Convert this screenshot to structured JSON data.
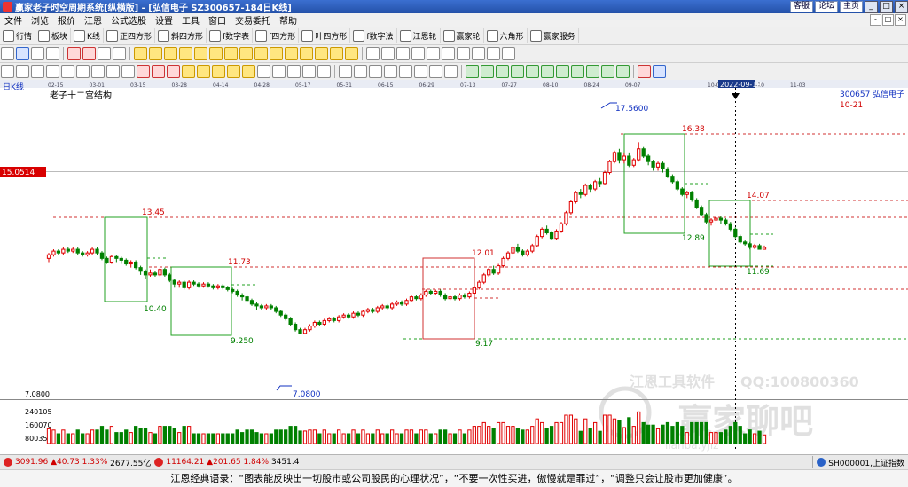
{
  "window": {
    "title": "赢家老子时空周期系统[纵横版] - [弘信电子  SZ300657-184日K线]",
    "links": [
      "客服",
      "论坛",
      "主页"
    ]
  },
  "menu": [
    "文件",
    "浏览",
    "报价",
    "江恩",
    "公式选股",
    "设置",
    "工具",
    "窗口",
    "交易委托",
    "帮助"
  ],
  "toolbar1": [
    "行情",
    "板块",
    "K线",
    "正四方形",
    "斜四方形",
    "f数字表",
    "f四方形",
    "叶四方形",
    "f数字法",
    "江恩轮",
    "赢家轮",
    "六角形",
    "赢家服务"
  ],
  "chart_data": {
    "type": "candlestick",
    "period_label": "日K线",
    "subtitle": "老子十二宫结构",
    "stock_code": "300657",
    "stock_name": "弘信电子",
    "date_axis": [
      "02-15",
      "03-01",
      "03-15",
      "03-28",
      "04-14",
      "04-28",
      "05-17",
      "05-31",
      "06-15",
      "06-29",
      "07-13",
      "07-27",
      "08-10",
      "08-24",
      "09-07",
      "2022-09-19",
      "10-06",
      "10-20",
      "11-03"
    ],
    "selected_date": "2022-09-19",
    "right_label": "10-21",
    "price_tag": "15.0514",
    "min_price_label": "7.0800",
    "volume_ticks": [
      "240105",
      "160070",
      "80035"
    ],
    "annotations": [
      {
        "text": "13.45",
        "color": "red"
      },
      {
        "text": "10.40",
        "color": "green"
      },
      {
        "text": "11.73",
        "color": "red"
      },
      {
        "text": "9.250",
        "color": "green"
      },
      {
        "text": "7.0800",
        "color": "blue"
      },
      {
        "text": "12.01",
        "color": "red"
      },
      {
        "text": "9.17",
        "color": "green"
      },
      {
        "text": "17.5600",
        "color": "blue"
      },
      {
        "text": "16.38",
        "color": "red"
      },
      {
        "text": "12.89",
        "color": "green"
      },
      {
        "text": "14.07",
        "color": "red"
      },
      {
        "text": "11.69",
        "color": "green"
      }
    ],
    "candles": [
      [
        11.2,
        11.4,
        11.0,
        11.5
      ],
      [
        11.4,
        11.6,
        11.3,
        11.7
      ],
      [
        11.6,
        11.5,
        11.4,
        11.7
      ],
      [
        11.5,
        11.7,
        11.4,
        11.8
      ],
      [
        11.7,
        11.6,
        11.5,
        11.8
      ],
      [
        11.6,
        11.7,
        11.5,
        11.8
      ],
      [
        11.7,
        11.5,
        11.4,
        11.8
      ],
      [
        11.5,
        11.4,
        11.3,
        11.6
      ],
      [
        11.4,
        11.5,
        11.3,
        11.6
      ],
      [
        11.5,
        11.7,
        11.4,
        11.8
      ],
      [
        11.7,
        11.5,
        11.4,
        11.8
      ],
      [
        11.5,
        11.2,
        11.1,
        11.6
      ],
      [
        11.2,
        11.0,
        10.9,
        11.3
      ],
      [
        11.0,
        11.3,
        10.9,
        11.4
      ],
      [
        11.3,
        11.2,
        11.0,
        11.4
      ],
      [
        11.2,
        11.1,
        10.9,
        11.3
      ],
      [
        11.1,
        10.9,
        10.8,
        11.2
      ],
      [
        10.9,
        11.0,
        10.7,
        11.1
      ],
      [
        11.0,
        10.7,
        10.6,
        11.1
      ],
      [
        10.7,
        10.5,
        10.3,
        10.8
      ],
      [
        10.5,
        10.3,
        10.1,
        10.6
      ],
      [
        10.3,
        10.4,
        10.2,
        10.6
      ],
      [
        10.4,
        10.3,
        10.2,
        10.5
      ],
      [
        10.3,
        10.6,
        10.2,
        10.7
      ],
      [
        10.6,
        10.3,
        10.2,
        10.7
      ],
      [
        10.3,
        10.0,
        9.9,
        10.4
      ],
      [
        10.0,
        9.8,
        9.6,
        10.1
      ],
      [
        9.8,
        9.9,
        9.6,
        10.0
      ],
      [
        9.9,
        9.6,
        9.5,
        10.0
      ],
      [
        9.6,
        9.9,
        9.5,
        10.0
      ],
      [
        9.9,
        9.8,
        9.7,
        10.0
      ],
      [
        9.8,
        9.7,
        9.6,
        9.9
      ],
      [
        9.7,
        9.8,
        9.6,
        9.9
      ],
      [
        9.8,
        9.7,
        9.6,
        9.9
      ],
      [
        9.7,
        9.6,
        9.5,
        9.8
      ],
      [
        9.6,
        9.7,
        9.5,
        9.8
      ],
      [
        9.7,
        9.6,
        9.5,
        9.8
      ],
      [
        9.6,
        9.5,
        9.4,
        9.7
      ],
      [
        9.5,
        9.4,
        9.3,
        9.6
      ],
      [
        9.4,
        9.2,
        9.1,
        9.5
      ],
      [
        9.2,
        9.1,
        8.9,
        9.3
      ],
      [
        9.1,
        8.9,
        8.8,
        9.2
      ],
      [
        8.9,
        8.7,
        8.6,
        9.0
      ],
      [
        8.7,
        8.6,
        8.4,
        8.8
      ],
      [
        8.6,
        8.5,
        8.4,
        8.7
      ],
      [
        8.5,
        8.6,
        8.4,
        8.7
      ],
      [
        8.6,
        8.5,
        8.4,
        8.7
      ],
      [
        8.5,
        8.3,
        8.2,
        8.6
      ],
      [
        8.3,
        8.1,
        8.0,
        8.4
      ],
      [
        8.1,
        7.9,
        7.8,
        8.2
      ],
      [
        7.9,
        7.6,
        7.5,
        8.0
      ],
      [
        7.6,
        7.3,
        7.2,
        7.7
      ],
      [
        7.3,
        7.1,
        7.08,
        7.4
      ],
      [
        7.1,
        7.3,
        7.08,
        7.4
      ],
      [
        7.3,
        7.5,
        7.2,
        7.6
      ],
      [
        7.5,
        7.7,
        7.4,
        7.8
      ],
      [
        7.7,
        7.6,
        7.5,
        7.8
      ],
      [
        7.6,
        7.8,
        7.5,
        7.9
      ],
      [
        7.8,
        7.9,
        7.7,
        8.0
      ],
      [
        7.9,
        7.8,
        7.7,
        8.0
      ],
      [
        7.8,
        8.0,
        7.7,
        8.1
      ],
      [
        8.0,
        8.1,
        7.9,
        8.2
      ],
      [
        8.1,
        8.0,
        7.9,
        8.2
      ],
      [
        8.0,
        8.2,
        7.9,
        8.3
      ],
      [
        8.2,
        8.1,
        8.0,
        8.3
      ],
      [
        8.1,
        8.3,
        8.0,
        8.4
      ],
      [
        8.3,
        8.4,
        8.2,
        8.5
      ],
      [
        8.4,
        8.3,
        8.2,
        8.5
      ],
      [
        8.3,
        8.5,
        8.2,
        8.6
      ],
      [
        8.5,
        8.6,
        8.4,
        8.7
      ],
      [
        8.6,
        8.5,
        8.4,
        8.7
      ],
      [
        8.5,
        8.7,
        8.4,
        8.8
      ],
      [
        8.7,
        8.8,
        8.6,
        8.9
      ],
      [
        8.8,
        8.7,
        8.6,
        8.9
      ],
      [
        8.7,
        8.9,
        8.6,
        9.0
      ],
      [
        8.9,
        9.1,
        8.8,
        9.2
      ],
      [
        9.1,
        9.0,
        8.9,
        9.2
      ],
      [
        9.0,
        9.2,
        8.9,
        9.3
      ],
      [
        9.2,
        9.4,
        9.1,
        9.5
      ],
      [
        9.4,
        9.3,
        9.2,
        9.5
      ],
      [
        9.3,
        9.4,
        9.2,
        9.5
      ],
      [
        9.4,
        9.2,
        9.1,
        9.5
      ],
      [
        9.2,
        9.0,
        8.9,
        9.3
      ],
      [
        9.0,
        9.1,
        8.9,
        9.2
      ],
      [
        9.1,
        9.0,
        8.9,
        9.2
      ],
      [
        9.0,
        9.2,
        8.9,
        9.3
      ],
      [
        9.2,
        9.1,
        9.0,
        9.3
      ],
      [
        9.1,
        9.3,
        9.0,
        9.4
      ],
      [
        9.3,
        9.6,
        9.2,
        9.7
      ],
      [
        9.6,
        9.9,
        9.5,
        10.0
      ],
      [
        9.9,
        10.3,
        9.8,
        10.4
      ],
      [
        10.3,
        10.6,
        10.2,
        10.7
      ],
      [
        10.6,
        10.4,
        10.3,
        10.8
      ],
      [
        10.4,
        10.8,
        10.3,
        10.9
      ],
      [
        10.8,
        11.2,
        10.7,
        11.3
      ],
      [
        11.2,
        11.5,
        11.1,
        11.6
      ],
      [
        11.5,
        11.8,
        11.4,
        11.9
      ],
      [
        11.8,
        11.6,
        11.5,
        12.0
      ],
      [
        11.6,
        11.4,
        11.3,
        11.7
      ],
      [
        11.4,
        11.6,
        11.3,
        11.7
      ],
      [
        11.6,
        11.9,
        11.5,
        12.0
      ],
      [
        11.9,
        12.4,
        11.8,
        12.5
      ],
      [
        12.4,
        12.8,
        12.3,
        12.9
      ],
      [
        12.8,
        12.6,
        12.5,
        13.0
      ],
      [
        12.6,
        12.3,
        12.2,
        12.7
      ],
      [
        12.3,
        12.7,
        12.2,
        12.8
      ],
      [
        12.7,
        13.1,
        12.6,
        13.2
      ],
      [
        13.1,
        13.7,
        13.0,
        13.8
      ],
      [
        13.7,
        14.3,
        13.6,
        14.4
      ],
      [
        14.3,
        14.8,
        14.2,
        14.9
      ],
      [
        14.8,
        14.7,
        14.5,
        15.0
      ],
      [
        14.7,
        15.2,
        14.6,
        15.3
      ],
      [
        15.2,
        15.0,
        14.8,
        15.3
      ],
      [
        15.0,
        15.4,
        14.9,
        15.5
      ],
      [
        15.4,
        15.3,
        15.1,
        15.6
      ],
      [
        15.3,
        15.9,
        15.2,
        16.0
      ],
      [
        15.9,
        16.5,
        15.8,
        16.6
      ],
      [
        16.5,
        17.0,
        16.4,
        17.1
      ],
      [
        17.0,
        16.6,
        16.4,
        17.2
      ],
      [
        16.6,
        16.8,
        16.4,
        17.0
      ],
      [
        16.8,
        16.3,
        16.2,
        17.0
      ],
      [
        16.3,
        16.6,
        16.2,
        16.7
      ],
      [
        16.6,
        17.2,
        16.5,
        17.56
      ],
      [
        17.2,
        16.8,
        16.7,
        17.3
      ],
      [
        16.8,
        16.5,
        16.3,
        16.9
      ],
      [
        16.5,
        16.2,
        16.0,
        16.6
      ],
      [
        16.2,
        16.4,
        16.0,
        16.5
      ],
      [
        16.4,
        16.1,
        15.9,
        16.5
      ],
      [
        16.1,
        15.7,
        15.6,
        16.2
      ],
      [
        15.7,
        15.4,
        15.3,
        15.8
      ],
      [
        15.4,
        15.0,
        14.9,
        15.5
      ],
      [
        15.0,
        14.7,
        14.6,
        15.1
      ],
      [
        14.7,
        14.8,
        14.5,
        14.9
      ],
      [
        14.8,
        14.4,
        14.3,
        14.9
      ],
      [
        14.4,
        14.0,
        13.9,
        14.5
      ],
      [
        14.0,
        13.6,
        13.5,
        14.1
      ],
      [
        13.6,
        13.2,
        13.1,
        13.7
      ],
      [
        13.2,
        13.3,
        13.0,
        13.4
      ],
      [
        13.3,
        13.4,
        13.1,
        13.5
      ],
      [
        13.4,
        13.3,
        13.1,
        13.5
      ],
      [
        13.3,
        13.1,
        13.0,
        13.4
      ],
      [
        13.1,
        12.8,
        12.7,
        13.2
      ],
      [
        12.8,
        12.4,
        12.3,
        12.9
      ],
      [
        12.4,
        12.1,
        12.0,
        12.5
      ],
      [
        12.1,
        12.0,
        11.9,
        12.2
      ],
      [
        12.0,
        11.8,
        11.69,
        12.1
      ],
      [
        11.8,
        11.9,
        11.7,
        12.0
      ],
      [
        11.9,
        11.7,
        11.69,
        12.0
      ],
      [
        11.7,
        11.8,
        11.69,
        11.9
      ]
    ]
  },
  "status": {
    "index1_value": "3091.96",
    "index1_change": "▲40.73",
    "index1_pct": "1.33%",
    "index1_amount": "2677.55亿",
    "index2_value": "11164.21",
    "index2_change": "▲201.65",
    "index2_pct": "1.84%",
    "index2_amount": "3451.4",
    "ticker": "SH000001,上证指数"
  },
  "quote": "江恩经典语录：“图表能反映出一切股市或公司股民的心理状况”，“不要一次性买进，傲慢就是罪过”，“调整只会让股市更加健康”。",
  "watermark": {
    "company": "江恩工具软件",
    "qq": "QQ:100800360",
    "forum": "赢家聊吧",
    "url": "lianba.yjlz"
  },
  "colors": {
    "up": "#e00000",
    "down": "#008000",
    "blue": "#1030c0"
  }
}
